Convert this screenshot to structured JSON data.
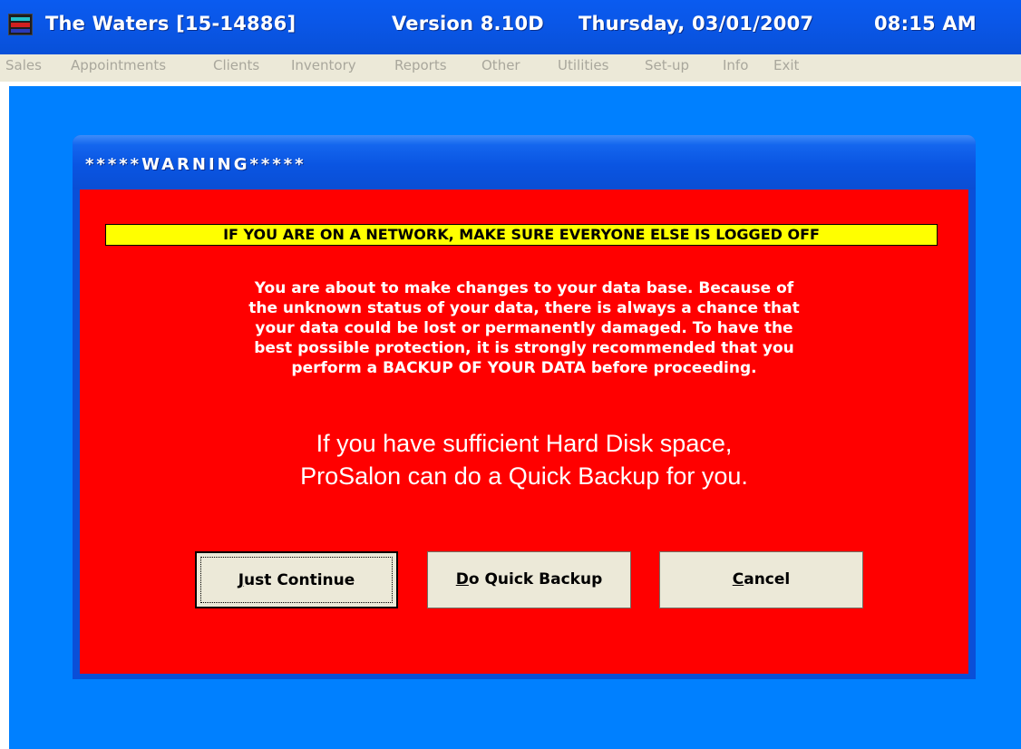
{
  "window": {
    "title_name": "The Waters [15-14886]",
    "title_version": "Version 8.10D",
    "title_date": "Thursday, 03/01/2007",
    "title_time": "08:15 AM",
    "icon": "prosalon-app-icon"
  },
  "menu": {
    "items": [
      {
        "label": "Sales"
      },
      {
        "label": "Appointments"
      },
      {
        "label": "Clients"
      },
      {
        "label": "Inventory"
      },
      {
        "label": "Reports"
      },
      {
        "label": "Other"
      },
      {
        "label": "Utilities"
      },
      {
        "label": "Set-up"
      },
      {
        "label": "Info"
      },
      {
        "label": "Exit"
      }
    ]
  },
  "dialog": {
    "title": "*****WARNING*****",
    "network_warning": "IF YOU ARE ON A NETWORK, MAKE SURE EVERYONE ELSE IS LOGGED OFF",
    "caution_lines": [
      "You are about to make changes to your data base.  Because of",
      "the unknown status of your data, there is always a chance that",
      "your data could be lost or permanently damaged.  To have the",
      "best possible protection, it is strongly recommended that you",
      "perform a BACKUP OF YOUR DATA before proceeding."
    ],
    "backup_lines": [
      "If you have sufficient Hard Disk space,",
      "ProSalon can do a Quick Backup for you."
    ],
    "buttons": {
      "continue": {
        "accel": "J",
        "rest": "ust Continue"
      },
      "backup": {
        "accel": "D",
        "rest": "o Quick Backup"
      },
      "cancel": {
        "accel": "C",
        "rest": "ancel"
      }
    }
  },
  "colors": {
    "titlebar_blue": "#0a57e8",
    "workspace_blue": "#0080ff",
    "dialog_red": "#ff0000",
    "banner_yellow": "#ffff00",
    "button_face": "#ece9d8",
    "menu_disabled_text": "#a9a79c"
  }
}
